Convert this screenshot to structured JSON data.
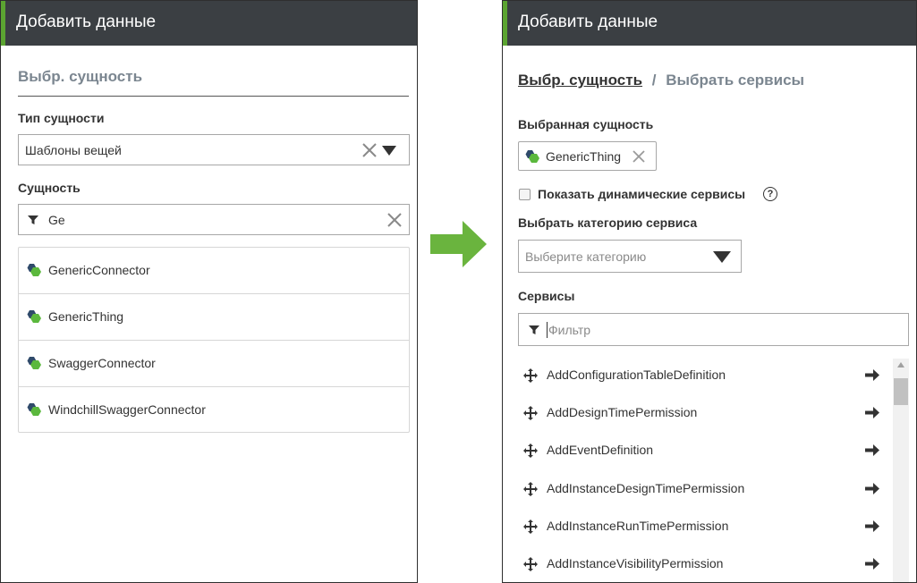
{
  "left_panel": {
    "header_title": "Добавить данные",
    "breadcrumb_current": "Выбр. сущность",
    "entity_type_label": "Тип сущности",
    "entity_type_value": "Шаблоны вещей",
    "entity_label": "Сущность",
    "entity_filter_value": "Ge",
    "results": [
      "GenericConnector",
      "GenericThing",
      "SwaggerConnector",
      "WindchillSwaggerConnector"
    ]
  },
  "right_panel": {
    "header_title": "Добавить данные",
    "breadcrumb_link": "Выбр. сущность",
    "breadcrumb_separator": "/",
    "breadcrumb_current": "Выбрать сервисы",
    "selected_entity_label": "Выбранная сущность",
    "selected_entity_chip": "GenericThing",
    "show_dynamic_label": "Показать динамические сервисы",
    "show_dynamic_checked": false,
    "help_glyph": "?",
    "category_label": "Выбрать категорию сервиса",
    "category_placeholder": "Выберите категорию",
    "services_label": "Сервисы",
    "services_filter_placeholder": "Фильтр",
    "services": [
      "AddConfigurationTableDefinition",
      "AddDesignTimePermission",
      "AddEventDefinition",
      "AddInstanceDesignTimePermission",
      "AddInstanceRunTimePermission",
      "AddInstanceVisibilityPermission"
    ]
  },
  "colors": {
    "header_bg": "#3b3f43",
    "header_accent": "#5ba431",
    "flow_arrow": "#6ab43e",
    "entity_icon_green": "#5bb83d",
    "entity_icon_navy": "#2f4a6a"
  },
  "icons": {
    "entity": "entity-hexagon-icon",
    "clear": "close-icon",
    "dropdown": "caret-down-icon",
    "filter": "filter-icon",
    "move": "move-icon",
    "add": "arrow-right-icon",
    "help": "help-icon"
  }
}
